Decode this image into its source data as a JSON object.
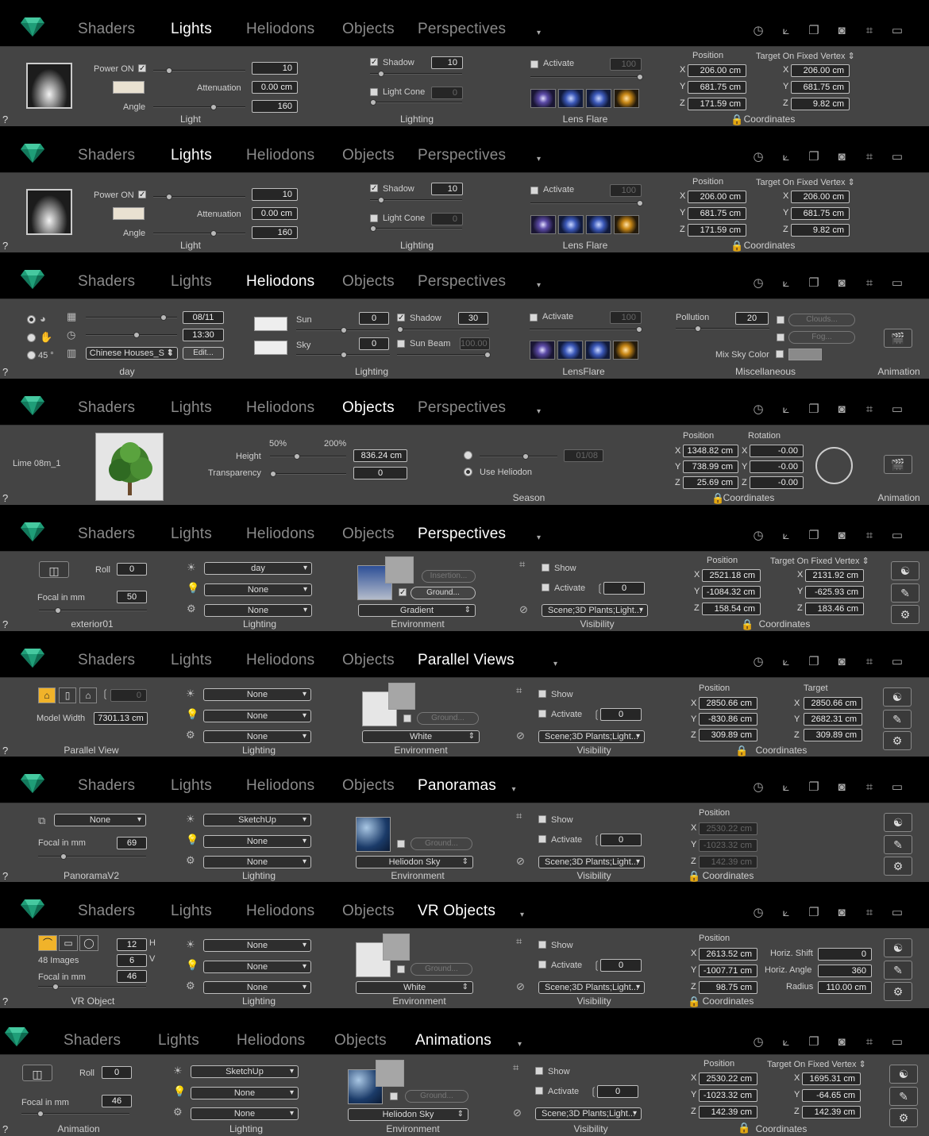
{
  "tabs_common": [
    "Shaders",
    "Lights",
    "Heliodons",
    "Objects"
  ],
  "panels": [
    {
      "last_tab": "Perspectives",
      "selected": "Lights"
    },
    {
      "last_tab": "Perspectives",
      "selected": "Lights"
    },
    {
      "last_tab": "Perspectives",
      "selected": "Heliodons"
    },
    {
      "last_tab": "Perspectives",
      "selected": "Objects"
    },
    {
      "last_tab": "Perspectives",
      "selected": "Perspectives"
    },
    {
      "last_tab": "Parallel Views",
      "selected": "Parallel Views"
    },
    {
      "last_tab": "Panoramas",
      "selected": "Panoramas"
    },
    {
      "last_tab": "VR Objects",
      "selected": "VR Objects"
    },
    {
      "last_tab": "Animations",
      "selected": "Animations"
    }
  ],
  "help": "?",
  "light": {
    "power_on": "Power ON",
    "attenuation": "Attenuation",
    "angle": "Angle",
    "power_val": "10",
    "att_val": "0.00 cm",
    "angle_val": "160",
    "section": "Light",
    "shadow": "Shadow",
    "shadow_val": "10",
    "light_cone": "Light Cone",
    "cone_val": "0",
    "lighting": "Lighting",
    "activate": "Activate",
    "activate_val": "100",
    "lens_flare": "Lens Flare",
    "position": "Position",
    "target": "Target On Fixed Vertex ⇕",
    "px": "206.00 cm",
    "py": "681.75 cm",
    "pz": "171.59 cm",
    "tx": "206.00 cm",
    "ty": "681.75 cm",
    "tz": "9.82 cm",
    "coordinates": "Coordinates"
  },
  "helio": {
    "deg": "45 °",
    "date": "08/11",
    "time": "13:30",
    "place": "Chinese Houses_S ⇕",
    "edit": "Edit...",
    "day": "day",
    "sun": "Sun",
    "sky": "Sky",
    "sun_val": "0",
    "sky_val": "0",
    "shadow": "Shadow",
    "shadow_val": "30",
    "sun_beam": "Sun Beam",
    "beam_val": "100.00",
    "lighting": "Lighting",
    "activate": "Activate",
    "act_val": "100",
    "lensflare": "LensFlare",
    "pollution": "Pollution",
    "poll_val": "20",
    "clouds": "Clouds...",
    "fog": "Fog...",
    "mix": "Mix Sky Color",
    "misc": "Miscellaneous",
    "animation": "Animation"
  },
  "obj": {
    "name": "Lime 08m_1",
    "p50": "50%",
    "p200": "200%",
    "height": "Height",
    "height_val": "836.24 cm",
    "transparency": "Transparency",
    "trans_val": "0",
    "season_val": "01/08",
    "use_helio": "Use Heliodon",
    "season": "Season",
    "position": "Position",
    "rotation": "Rotation",
    "px": "1348.82 cm",
    "py": "738.99 cm",
    "pz": "25.69 cm",
    "rx": "-0.00",
    "ry": "-0.00",
    "rz": "-0.00",
    "coordinates": "Coordinates",
    "animation": "Animation"
  },
  "persp": {
    "roll": "Roll",
    "roll_val": "0",
    "focal": "Focal in mm",
    "focal_val": "50",
    "name": "exterior01",
    "l1": "day",
    "l2": "None",
    "l3": "None",
    "lighting": "Lighting",
    "insertion": "Insertion...",
    "ground": "Ground...",
    "gradient": "Gradient",
    "environment": "Environment",
    "show": "Show",
    "activate": "Activate",
    "act_val": "0",
    "scene": "Scene;3D Plants;Light...",
    "visibility": "Visibility",
    "position": "Position",
    "target": "Target On Fixed Vertex ⇕",
    "px": "2521.18 cm",
    "py": "-1084.32 cm",
    "pz": "158.54 cm",
    "tx": "2131.92 cm",
    "ty": "-625.93 cm",
    "tz": "183.46 cm",
    "coordinates": "Coordinates"
  },
  "par": {
    "mode_val": "0",
    "model_width": "Model Width",
    "mw_val": "7301.13 cm",
    "name": "Parallel View",
    "l1": "None",
    "l2": "None",
    "l3": "None",
    "lighting": "Lighting",
    "ground": "Ground...",
    "white": "White",
    "environment": "Environment",
    "show": "Show",
    "activate": "Activate",
    "act_val": "0",
    "scene": "Scene;3D Plants;Light...",
    "visibility": "Visibility",
    "position": "Position",
    "target": "Target",
    "px": "2850.66 cm",
    "py": "-830.86 cm",
    "pz": "309.89 cm",
    "tx": "2850.66 cm",
    "ty": "2682.31 cm",
    "tz": "309.89 cm",
    "coordinates": "Coordinates"
  },
  "pan": {
    "mode": "None",
    "focal": "Focal in mm",
    "focal_val": "69",
    "name": "PanoramaV2",
    "l1": "SketchUp",
    "l2": "None",
    "l3": "None",
    "lighting": "Lighting",
    "ground": "Ground...",
    "sky": "Heliodon Sky",
    "environment": "Environment",
    "show": "Show",
    "activate": "Activate",
    "act_val": "0",
    "scene": "Scene;3D Plants;Light...",
    "visibility": "Visibility",
    "position": "Position",
    "px": "2530.22 cm",
    "py": "-1023.32 cm",
    "pz": "142.39 cm",
    "coordinates": "Coordinates"
  },
  "vr": {
    "h_val": "12",
    "h": "H",
    "images": "48 Images",
    "v_val": "6",
    "v": "V",
    "focal": "Focal in mm",
    "focal_val": "46",
    "name": "VR Object",
    "l1": "None",
    "l2": "None",
    "l3": "None",
    "lighting": "Lighting",
    "ground": "Ground...",
    "white": "White",
    "environment": "Environment",
    "show": "Show",
    "activate": "Activate",
    "act_val": "0",
    "scene": "Scene;3D Plants;Light...",
    "visibility": "Visibility",
    "position": "Position",
    "px": "2613.52 cm",
    "py": "-1007.71 cm",
    "pz": "98.75 cm",
    "hshift": "Horiz. Shift",
    "hshift_val": "0",
    "hangle": "Horiz. Angle",
    "hangle_val": "360",
    "radius": "Radius",
    "radius_val": "110.00 cm",
    "coordinates": "Coordinates"
  },
  "anim": {
    "roll": "Roll",
    "roll_val": "0",
    "focal": "Focal in mm",
    "focal_val": "46",
    "name": "Animation",
    "l1": "SketchUp",
    "l2": "None",
    "l3": "None",
    "lighting": "Lighting",
    "ground": "Ground...",
    "sky": "Heliodon Sky",
    "environment": "Environment",
    "show": "Show",
    "activate": "Activate",
    "act_val": "0",
    "scene": "Scene;3D Plants;Light...",
    "visibility": "Visibility",
    "position": "Position",
    "target": "Target On Fixed Vertex ⇕",
    "px": "2530.22 cm",
    "py": "-1023.32 cm",
    "pz": "142.39 cm",
    "tx": "1695.31 cm",
    "ty": "-64.65 cm",
    "tz": "142.39 cm",
    "coordinates": "Coordinates"
  },
  "axes": {
    "x": "X",
    "y": "Y",
    "z": "Z"
  }
}
